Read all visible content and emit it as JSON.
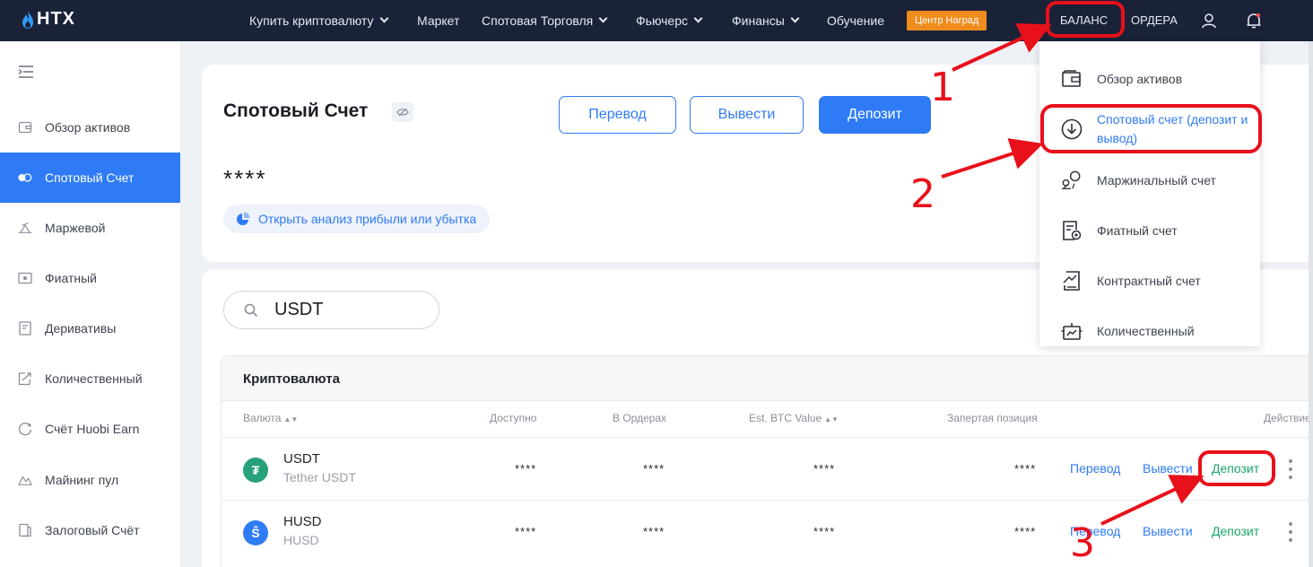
{
  "header": {
    "logo_text": "HTX",
    "nav": [
      {
        "label": "Купить криптовалюту",
        "dropdown": true
      },
      {
        "label": "Маркет",
        "dropdown": false
      },
      {
        "label": "Спотовая Торговля",
        "dropdown": true
      },
      {
        "label": "Фьючерс",
        "dropdown": true
      },
      {
        "label": "Финансы",
        "dropdown": true
      },
      {
        "label": "Обучение",
        "dropdown": false
      }
    ],
    "reward_badge": "Центр Наград",
    "balance_label": "БАЛАНС",
    "orders_label": "ОРДЕРА",
    "icons": [
      "user-icon",
      "bell-icon"
    ]
  },
  "sidebar": {
    "items": [
      {
        "label": "Обзор активов",
        "icon": "wallet-icon",
        "active": false
      },
      {
        "label": "Спотовый Счет",
        "icon": "spot-icon",
        "active": true
      },
      {
        "label": "Маржевой",
        "icon": "margin-icon",
        "active": false
      },
      {
        "label": "Фиатный",
        "icon": "fiat-icon",
        "active": false
      },
      {
        "label": "Деривативы",
        "icon": "derivatives-icon",
        "active": false
      },
      {
        "label": "Количественный",
        "icon": "quant-icon",
        "active": false
      },
      {
        "label": "Счёт Huobi Earn",
        "icon": "earn-icon",
        "active": false
      },
      {
        "label": "Майнинг пул",
        "icon": "mining-icon",
        "active": false
      },
      {
        "label": "Залоговый Счёт",
        "icon": "collateral-icon",
        "active": false
      }
    ]
  },
  "account": {
    "title": "Спотовый Счет",
    "transfer_label": "Перевод",
    "withdraw_label": "Вывести",
    "deposit_label": "Депозит",
    "balance_masked": "****",
    "pnl_link": "Открыть анализ прибыли или убытка"
  },
  "search": {
    "value": "USDT"
  },
  "table": {
    "title": "Криптовалюта",
    "columns": [
      "Валюта",
      "Доступно",
      "В Ордерах",
      "Est. BTC Value",
      "Запертая позиция",
      "Действие"
    ],
    "rows": [
      {
        "symbol": "USDT",
        "name": "Tether USDT",
        "available": "****",
        "in_orders": "****",
        "btc_value": "****",
        "locked": "****",
        "color": "#26a17b",
        "glyph": "₮"
      },
      {
        "symbol": "HUSD",
        "name": "HUSD",
        "available": "****",
        "in_orders": "****",
        "btc_value": "****",
        "locked": "****",
        "color": "#2f7bf5",
        "glyph": "Ŝ"
      }
    ],
    "actions": {
      "transfer": "Перевод",
      "withdraw": "Вывести",
      "deposit": "Депозит"
    }
  },
  "dropdown": {
    "items": [
      {
        "label": "Обзор активов",
        "icon": "wallet-icon"
      },
      {
        "label": "Спотовый счет (депозит и вывод)",
        "icon": "download-circle-icon",
        "active": true
      },
      {
        "label": "Маржинальный счет",
        "icon": "margin-scale-icon"
      },
      {
        "label": "Фиатный счет",
        "icon": "fiat-doc-icon"
      },
      {
        "label": "Контрактный счет",
        "icon": "contract-icon"
      },
      {
        "label": "Количественный",
        "icon": "quant-robot-icon"
      }
    ]
  },
  "annotations": {
    "step1": "1",
    "step2": "2",
    "step3": "3",
    "color": "#e8101a"
  }
}
